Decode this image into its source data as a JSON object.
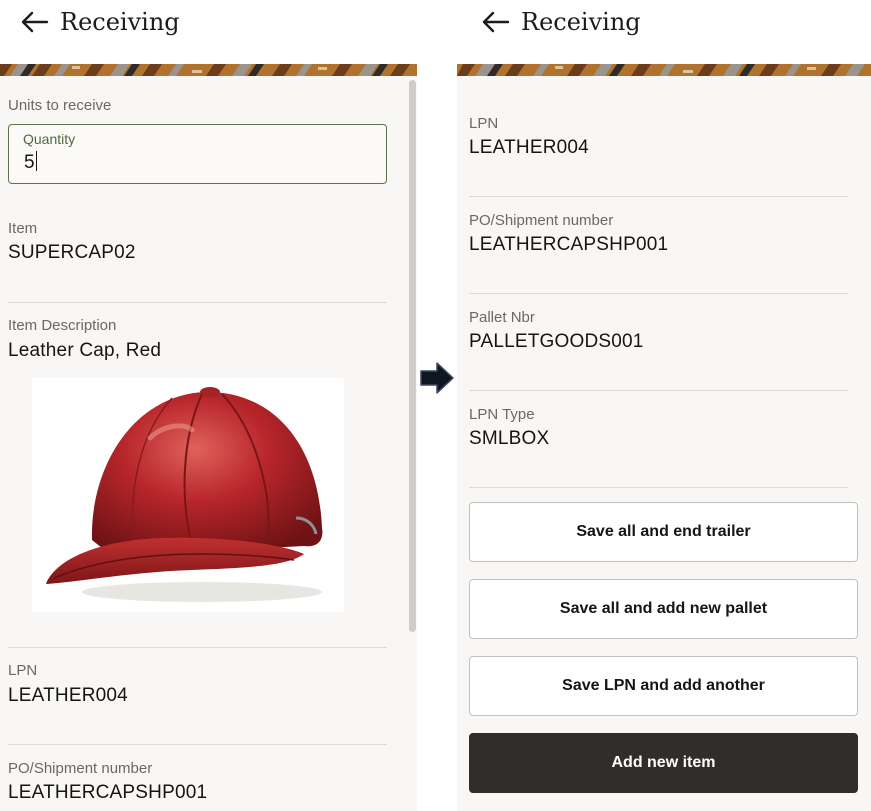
{
  "left_screen": {
    "header": {
      "title": "Receiving",
      "back_icon": "arrow-left-icon"
    },
    "units_to_receive_label": "Units to receive",
    "quantity": {
      "label": "Quantity",
      "value": "5"
    },
    "item": {
      "label": "Item",
      "value": "SUPERCAP02"
    },
    "item_description": {
      "label": "Item Description",
      "value": "Leather Cap, Red"
    },
    "lpn": {
      "label": "LPN",
      "value": "LEATHER004"
    },
    "po_shipment": {
      "label": "PO/Shipment number",
      "value": "LEATHERCAPSHP001"
    }
  },
  "transition_icon": "arrow-right-icon",
  "right_screen": {
    "header": {
      "title": "Receiving",
      "back_icon": "arrow-left-icon"
    },
    "fields": [
      {
        "label": "LPN",
        "value": "LEATHER004"
      },
      {
        "label": "PO/Shipment number",
        "value": "LEATHERCAPSHP001"
      },
      {
        "label": "Pallet Nbr",
        "value": "PALLETGOODS001"
      },
      {
        "label": "LPN Type",
        "value": "SMLBOX"
      }
    ],
    "buttons": {
      "save_end_trailer": "Save all and end trailer",
      "save_new_pallet": "Save all and add new pallet",
      "save_lpn_another": "Save LPN and add another",
      "add_new_item": "Add new item"
    }
  },
  "colors": {
    "background": "#f8f7f5",
    "field_border_active": "#5a7548",
    "primary_button": "#312d2a",
    "cap_red": "#b5262a"
  }
}
